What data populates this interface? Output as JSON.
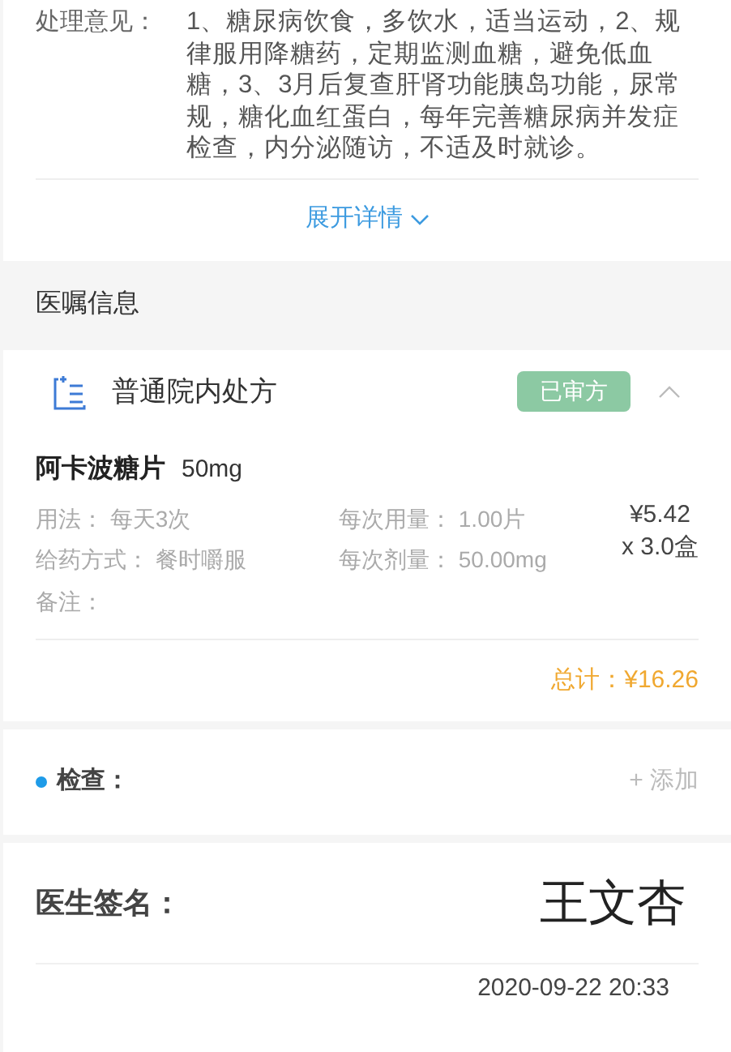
{
  "treatment": {
    "label": "处理意见：",
    "text": "1、糖尿病饮食，多饮水，适当运动，2、规律服用降糖药，定期监测血糖，避免低血糖，3、3月后复查肝肾功能胰岛功能，尿常规，糖化血红蛋白，每年完善糖尿病并发症检查，内分泌随访，不适及时就诊。"
  },
  "expand_link": {
    "label": "展开详情"
  },
  "orders_section": {
    "title": "医嘱信息"
  },
  "prescription": {
    "title": "普通院内处方",
    "status": "已审方",
    "expanded": true,
    "drugs": [
      {
        "name": "阿卡波糖片",
        "spec": "50mg",
        "price": "¥5.42",
        "quantity": "x 3.0盒",
        "fields": [
          {
            "label": "用法：",
            "value": "每天3次"
          },
          {
            "label": "每次用量：",
            "value": "1.00片"
          },
          {
            "label": "给药方式：",
            "value": "餐时嚼服"
          },
          {
            "label": "每次剂量：",
            "value": "50.00mg"
          },
          {
            "label": "备注："
          }
        ]
      }
    ],
    "total": "总计：¥16.26"
  },
  "check": {
    "label": "检查：",
    "add": "+ 添加"
  },
  "signature": {
    "label": "医生签名：",
    "name": "王文杏",
    "date": "2020-09-22 20:33"
  }
}
